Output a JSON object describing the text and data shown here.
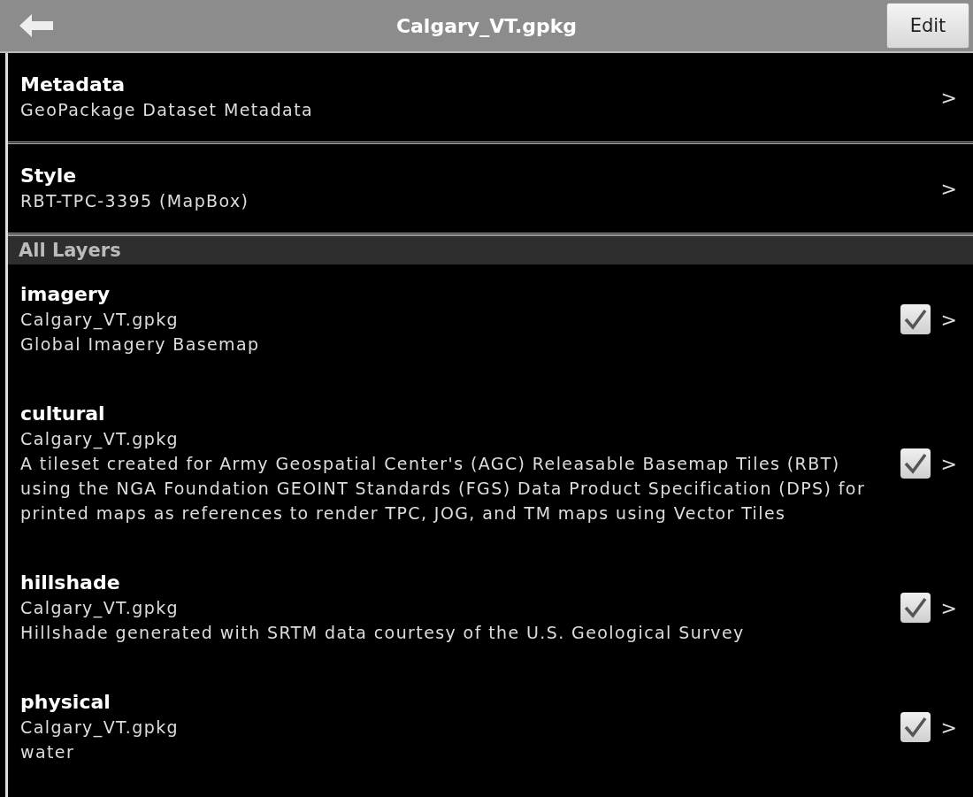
{
  "header": {
    "title": "Calgary_VT.gpkg",
    "edit_button": "Edit"
  },
  "nav_items": [
    {
      "title": "Metadata",
      "subtitle": "GeoPackage Dataset Metadata",
      "chevron": ">"
    },
    {
      "title": "Style",
      "subtitle": "RBT-TPC-3395 (MapBox)",
      "chevron": ">"
    }
  ],
  "section_header": "All Layers",
  "layers": [
    {
      "name": "imagery",
      "file": "Calgary_VT.gpkg",
      "description": "Global Imagery Basemap",
      "checked": true,
      "chevron": ">"
    },
    {
      "name": "cultural",
      "file": "Calgary_VT.gpkg",
      "description": "A tileset created for Army Geospatial Center's (AGC) Releasable Basemap Tiles (RBT) using the NGA Foundation GEOINT Standards (FGS) Data Product Specification (DPS) for printed maps as references to render TPC, JOG, and TM maps using Vector Tiles",
      "checked": true,
      "chevron": ">"
    },
    {
      "name": "hillshade",
      "file": "Calgary_VT.gpkg",
      "description": "Hillshade generated with SRTM data courtesy of the U.S. Geological Survey",
      "checked": true,
      "chevron": ">"
    },
    {
      "name": "physical",
      "file": "Calgary_VT.gpkg",
      "description": "water",
      "checked": true,
      "chevron": ">"
    }
  ]
}
